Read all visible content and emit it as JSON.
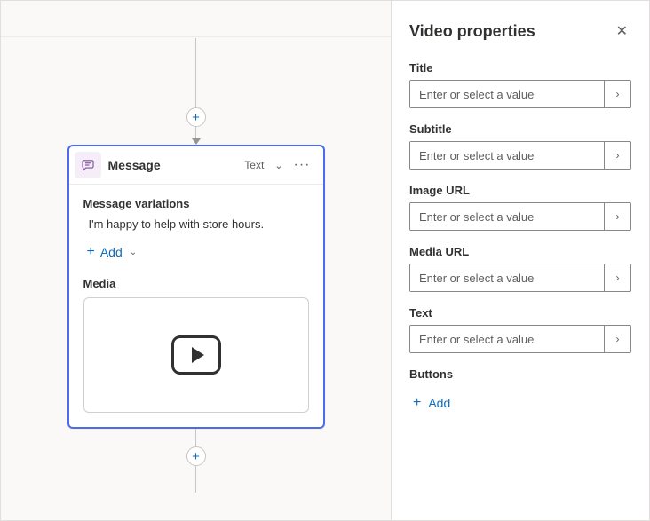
{
  "canvas": {
    "card": {
      "title": "Message",
      "typeLabel": "Text",
      "variations": {
        "label": "Message variations",
        "text": "I'm happy to help with store hours.",
        "addLabel": "Add"
      },
      "media": {
        "label": "Media"
      }
    }
  },
  "panel": {
    "title": "Video properties",
    "fields": {
      "title": {
        "label": "Title",
        "placeholder": "Enter or select a value",
        "value": ""
      },
      "subtitle": {
        "label": "Subtitle",
        "placeholder": "Enter or select a value",
        "value": ""
      },
      "imageUrl": {
        "label": "Image URL",
        "placeholder": "Enter or select a value",
        "value": ""
      },
      "mediaUrl": {
        "label": "Media URL",
        "placeholder": "Enter or select a value",
        "value": ""
      },
      "text": {
        "label": "Text",
        "placeholder": "Enter or select a value",
        "value": ""
      }
    },
    "buttons": {
      "label": "Buttons",
      "addLabel": "Add"
    }
  }
}
